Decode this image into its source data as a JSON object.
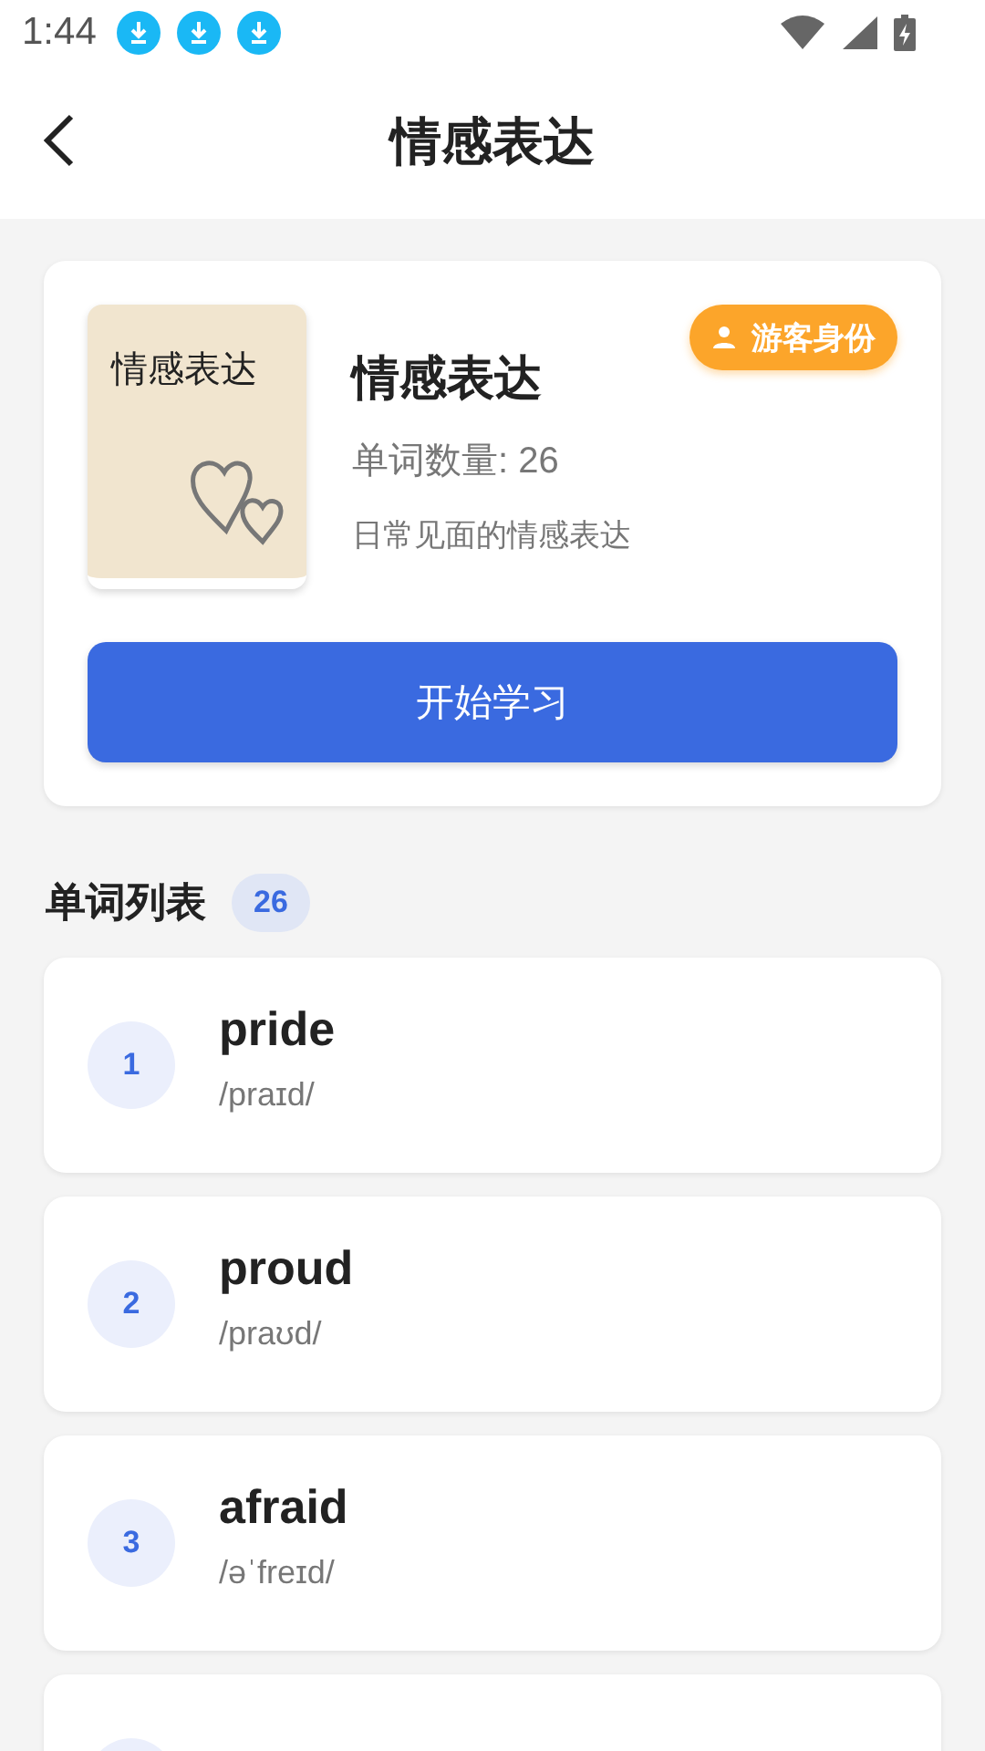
{
  "status_bar": {
    "time": "1:44",
    "notifications": [
      {
        "kind": "download"
      },
      {
        "kind": "download"
      },
      {
        "kind": "download"
      }
    ]
  },
  "header": {
    "title": "情感表达"
  },
  "book": {
    "cover_title": "情感表达",
    "title": "情感表达",
    "badge": "游客身份",
    "count": "单词数量: 26",
    "description": "日常见面的情感表达",
    "start_button": "开始学习"
  },
  "word_list": {
    "title": "单词列表",
    "count": "26",
    "items": [
      {
        "kind": "word",
        "number": "1",
        "word": "pride",
        "phonetic": "/praɪd/"
      },
      {
        "kind": "word",
        "number": "2",
        "word": "proud",
        "phonetic": "/praʊd/"
      },
      {
        "kind": "word",
        "number": "3",
        "word": "afraid",
        "phonetic": "/əˈfreɪd/"
      },
      {
        "kind": "clipped"
      }
    ]
  }
}
